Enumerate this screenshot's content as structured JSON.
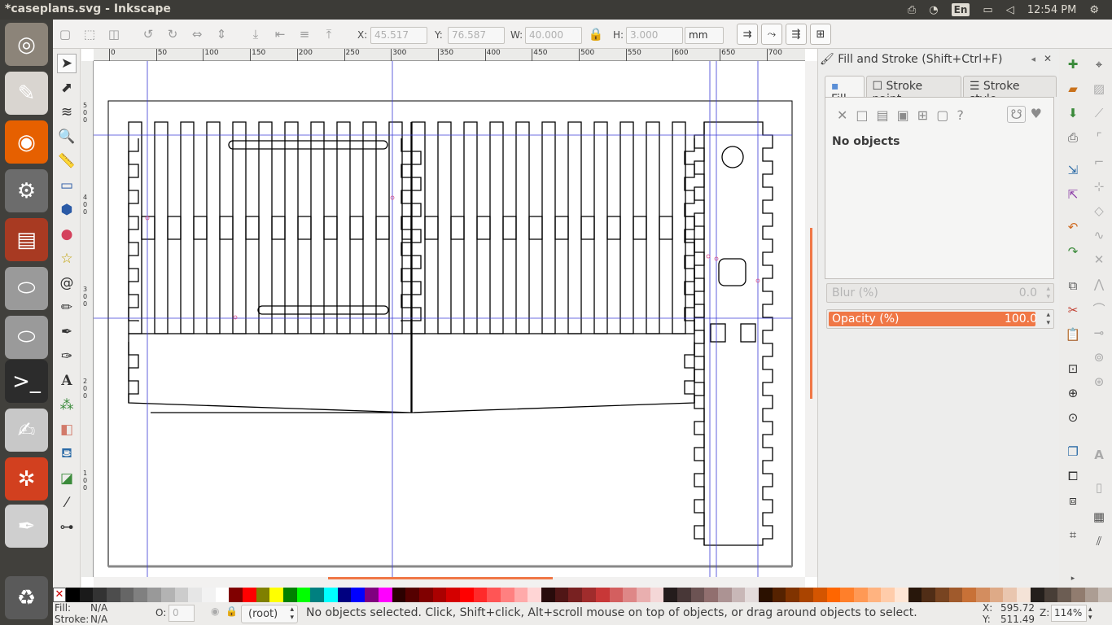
{
  "window": {
    "title": "*caseplans.svg - Inkscape"
  },
  "tray": {
    "lang": "En",
    "time": "12:54 PM"
  },
  "launcher": [
    {
      "name": "ubuntu-dash-icon",
      "glyph": "◎",
      "color": "#8c8479"
    },
    {
      "name": "document-viewer-icon",
      "glyph": "✎",
      "color": "#d9d5d0"
    },
    {
      "name": "firefox-icon",
      "glyph": "◉",
      "color": "#e66000"
    },
    {
      "name": "system-settings-icon",
      "glyph": "⚙",
      "color": "#6c6c6c"
    },
    {
      "name": "files-icon",
      "glyph": "▤",
      "color": "#a83a22"
    },
    {
      "name": "disk-icon",
      "glyph": "⬭",
      "color": "#9a9a9a"
    },
    {
      "name": "disk-2-icon",
      "glyph": "⬭",
      "color": "#9a9a9a"
    },
    {
      "name": "terminal-icon",
      "glyph": ">_",
      "color": "#2c2c2c"
    },
    {
      "name": "text-editor-icon",
      "glyph": "✍",
      "color": "#c8c8c8"
    },
    {
      "name": "gear-app-icon",
      "glyph": "✲",
      "color": "#d2401f"
    },
    {
      "name": "inkscape-icon",
      "glyph": "✒",
      "color": "#cfcfcf"
    },
    {
      "name": "trash-icon",
      "glyph": "♻",
      "color": "#5a5a5a"
    }
  ],
  "toolbar": {
    "x_label": "X:",
    "x_value": "45.517",
    "y_label": "Y:",
    "y_value": "76.587",
    "w_label": "W:",
    "w_value": "40.000",
    "h_label": "H:",
    "h_value": "3.000",
    "unit": "mm"
  },
  "ruler": {
    "ticks": [
      "0",
      "50",
      "100",
      "150",
      "200",
      "250",
      "300",
      "350",
      "400",
      "450",
      "500",
      "550",
      "600",
      "650",
      "700"
    ],
    "left": [
      "5 0 0",
      "4 0 0",
      "3 0 0",
      "2 0 0",
      "1 0 0"
    ]
  },
  "panel": {
    "title": "Fill and Stroke (Shift+Ctrl+F)",
    "tabs": [
      "Fill",
      "Stroke paint",
      "Stroke style"
    ],
    "message": "No objects",
    "blur_label": "Blur (%)",
    "blur_value": "0.0",
    "opacity_label": "Opacity (%)",
    "opacity_value": "100.0",
    "accent": "#f07746"
  },
  "palette": [
    "#000000",
    "#1a1a1a",
    "#333333",
    "#4d4d4d",
    "#666666",
    "#808080",
    "#999999",
    "#b3b3b3",
    "#cccccc",
    "#e6e6e6",
    "#f2f2f2",
    "#ffffff",
    "#800000",
    "#ff0000",
    "#808000",
    "#ffff00",
    "#008000",
    "#00ff00",
    "#008080",
    "#00ffff",
    "#000080",
    "#0000ff",
    "#800080",
    "#ff00ff",
    "#2b0000",
    "#550000",
    "#800000",
    "#aa0000",
    "#d40000",
    "#ff0000",
    "#ff2a2a",
    "#ff5555",
    "#ff8080",
    "#ffaaaa",
    "#ffd5d5",
    "#280b0b",
    "#501616",
    "#782121",
    "#a02c2c",
    "#c83737",
    "#d35f5f",
    "#de8787",
    "#e9afaf",
    "#f4d7d7",
    "#241c1c",
    "#483737",
    "#6c5353",
    "#916f6f",
    "#ac9393",
    "#c8b7b7",
    "#e3dbdb",
    "#2b1100",
    "#552200",
    "#803300",
    "#aa4400",
    "#d45500",
    "#ff6600",
    "#ff7f2a",
    "#ff9955",
    "#ffb380",
    "#ffccaa",
    "#ffe6d5",
    "#28170b",
    "#502d16",
    "#784421",
    "#a05a2c",
    "#c87137",
    "#d38d5f",
    "#deaa87",
    "#e9c6af",
    "#f4e3d7",
    "#241f1c",
    "#483e37",
    "#6c5d53",
    "#917c6f",
    "#ac9d93",
    "#c8beb7"
  ],
  "status": {
    "fill_label": "Fill:",
    "fill_value": "N/A",
    "stroke_label": "Stroke:",
    "stroke_value": "N/A",
    "o_label": "O:",
    "o_value": "0",
    "layer": "(root)",
    "message": "No objects selected. Click, Shift+click, Alt+scroll mouse on top of objects, or drag around objects to select.",
    "x_label": "X:",
    "x_value": "595.72",
    "y_label": "Y:",
    "y_value": "511.49",
    "z_label": "Z:",
    "zoom": "114%"
  }
}
